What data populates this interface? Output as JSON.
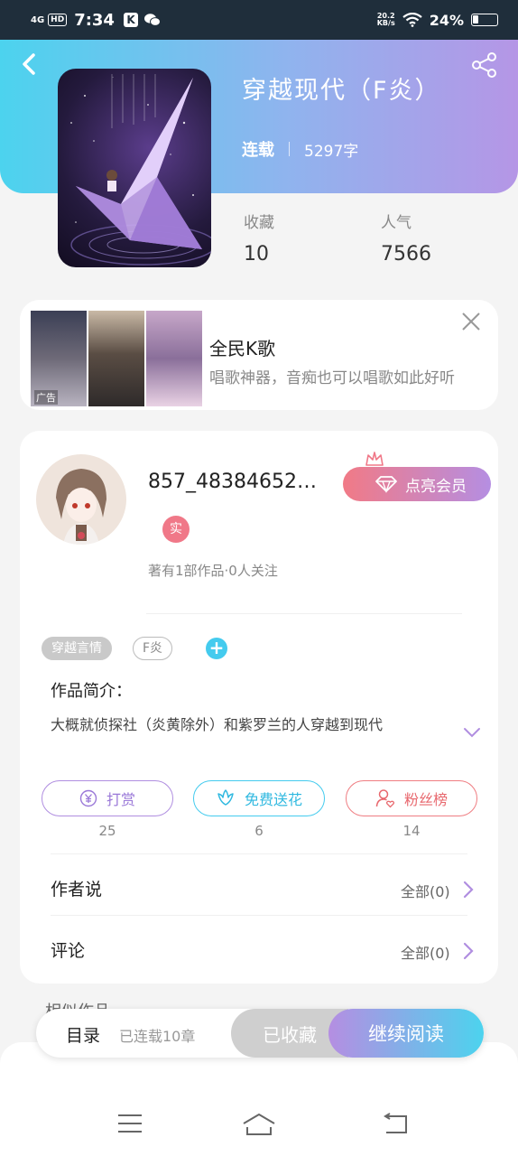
{
  "status_bar": {
    "network": "4G",
    "hd": "HD",
    "time": "7:34",
    "app_k": "K",
    "speed_value": "20.2",
    "speed_unit": "KB/s",
    "battery": "24%"
  },
  "book": {
    "title": "穿越现代（F炎）",
    "serial_status": "连载",
    "word_count": "5297字",
    "collect_label": "收藏",
    "collect_value": "10",
    "popularity_label": "人气",
    "popularity_value": "7566"
  },
  "ad": {
    "tag": "广告",
    "title": "全民K歌",
    "description": "唱歌神器，音痴也可以唱歌如此好听"
  },
  "author": {
    "name": "857_48384652…",
    "vip_button": "点亮会员",
    "real_badge": "实",
    "stats": "著有1部作品·0人关注"
  },
  "tags": [
    "穿越言情",
    "F炎"
  ],
  "tag_add": "+",
  "intro": {
    "label": "作品简介：",
    "text": "大概就侦探社（炎黄除外）和紫罗兰的人穿越到现代"
  },
  "actions": [
    {
      "label": "打赏",
      "count": "25",
      "color": "#9a78d8"
    },
    {
      "label": "免费送花",
      "count": "6",
      "color": "#30b9e0"
    },
    {
      "label": "粉丝榜",
      "count": "14",
      "color": "#e8686e"
    }
  ],
  "rows": {
    "author_says": {
      "label": "作者说",
      "value": "全部(0)"
    },
    "comments": {
      "label": "评论",
      "value": "全部(0)"
    }
  },
  "similar_title": "相似作品",
  "bottom_bar": {
    "toc_label": "目录",
    "toc_status": "已连载10章",
    "collected": "已收藏",
    "continue": "继续阅读"
  },
  "colors": {
    "header_start": "#4cd3ee",
    "header_end": "#b596e6",
    "vip_start": "#f17a86",
    "vip_end": "#b58ee2"
  }
}
